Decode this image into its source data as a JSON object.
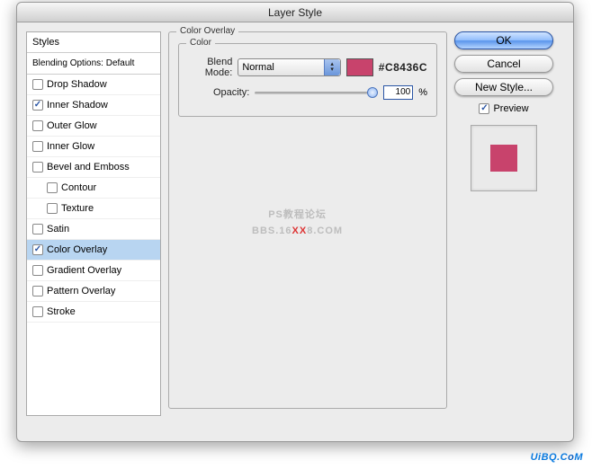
{
  "dialog": {
    "title": "Layer Style"
  },
  "styles_panel": {
    "header": "Styles",
    "blending": "Blending Options: Default",
    "items": [
      {
        "label": "Drop Shadow",
        "checked": false,
        "indent": false,
        "selected": false
      },
      {
        "label": "Inner Shadow",
        "checked": true,
        "indent": false,
        "selected": false
      },
      {
        "label": "Outer Glow",
        "checked": false,
        "indent": false,
        "selected": false
      },
      {
        "label": "Inner Glow",
        "checked": false,
        "indent": false,
        "selected": false
      },
      {
        "label": "Bevel and Emboss",
        "checked": false,
        "indent": false,
        "selected": false
      },
      {
        "label": "Contour",
        "checked": false,
        "indent": true,
        "selected": false
      },
      {
        "label": "Texture",
        "checked": false,
        "indent": true,
        "selected": false
      },
      {
        "label": "Satin",
        "checked": false,
        "indent": false,
        "selected": false
      },
      {
        "label": "Color Overlay",
        "checked": true,
        "indent": false,
        "selected": true
      },
      {
        "label": "Gradient Overlay",
        "checked": false,
        "indent": false,
        "selected": false
      },
      {
        "label": "Pattern Overlay",
        "checked": false,
        "indent": false,
        "selected": false
      },
      {
        "label": "Stroke",
        "checked": false,
        "indent": false,
        "selected": false
      }
    ]
  },
  "overlay": {
    "group_label": "Color Overlay",
    "color_group": "Color",
    "blend_mode_label": "Blend Mode:",
    "blend_mode_value": "Normal",
    "swatch_color": "#C8436C",
    "hex_text": "#C8436C",
    "opacity_label": "Opacity:",
    "opacity_value": "100",
    "opacity_unit": "%"
  },
  "buttons": {
    "ok": "OK",
    "cancel": "Cancel",
    "new_style": "New Style...",
    "preview": "Preview"
  },
  "watermark": {
    "line1": "PS教程论坛",
    "line2a": "BBS.16",
    "xx": "XX",
    "line2b": "8.COM"
  },
  "brand": {
    "text_a": "UiBQ.C",
    "text_b": "o",
    "text_c": "M"
  }
}
